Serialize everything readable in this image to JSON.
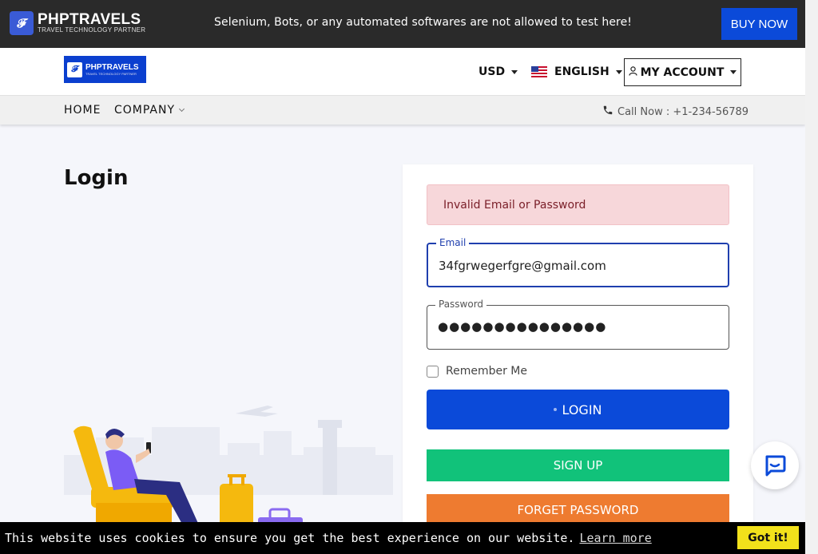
{
  "topbar": {
    "logo_name": "PHPTRAVELS",
    "logo_tagline": "TRAVEL TECHNOLOGY PARTNER",
    "notice": "Selenium, Bots, or any automated softwares are not allowed to test here!",
    "buy_now": "BUY NOW"
  },
  "header": {
    "brand_name": "PHPTRAVELS",
    "brand_tagline": "TRAVEL TECHNOLOGY PARTNER",
    "currency": "USD",
    "language": "ENGLISH",
    "account": "MY ACCOUNT"
  },
  "nav": {
    "items": [
      {
        "label": "HOME"
      },
      {
        "label": "COMPANY"
      }
    ],
    "call": "Call Now : +1-234-56789"
  },
  "page": {
    "title": "Login"
  },
  "form": {
    "error": "Invalid Email or Password",
    "email_label": "Email",
    "email_value": "34fgrwegerfgre@gmail.com",
    "password_label": "Password",
    "password_value": "●●●●●●●●●●●●●●●",
    "remember": "Remember Me",
    "remember_checked": false,
    "login": "LOGIN",
    "signup": "SIGN UP",
    "forget": "FORGET PASSWORD"
  },
  "cookie": {
    "text": "This website uses cookies to ensure you get the best experience on our website.",
    "link": "Learn more",
    "button": "Got it!"
  },
  "colors": {
    "primary": "#0b4ad9",
    "success": "#11c27a",
    "warning": "#ee7b30",
    "alert_bg": "#f7d7da",
    "topbar_bg": "#2a2a2a"
  },
  "icons": [
    "logo-icon",
    "caret-down-icon",
    "us-flag-icon",
    "user-icon",
    "chevron-down-icon",
    "phone-icon",
    "chat-icon"
  ]
}
